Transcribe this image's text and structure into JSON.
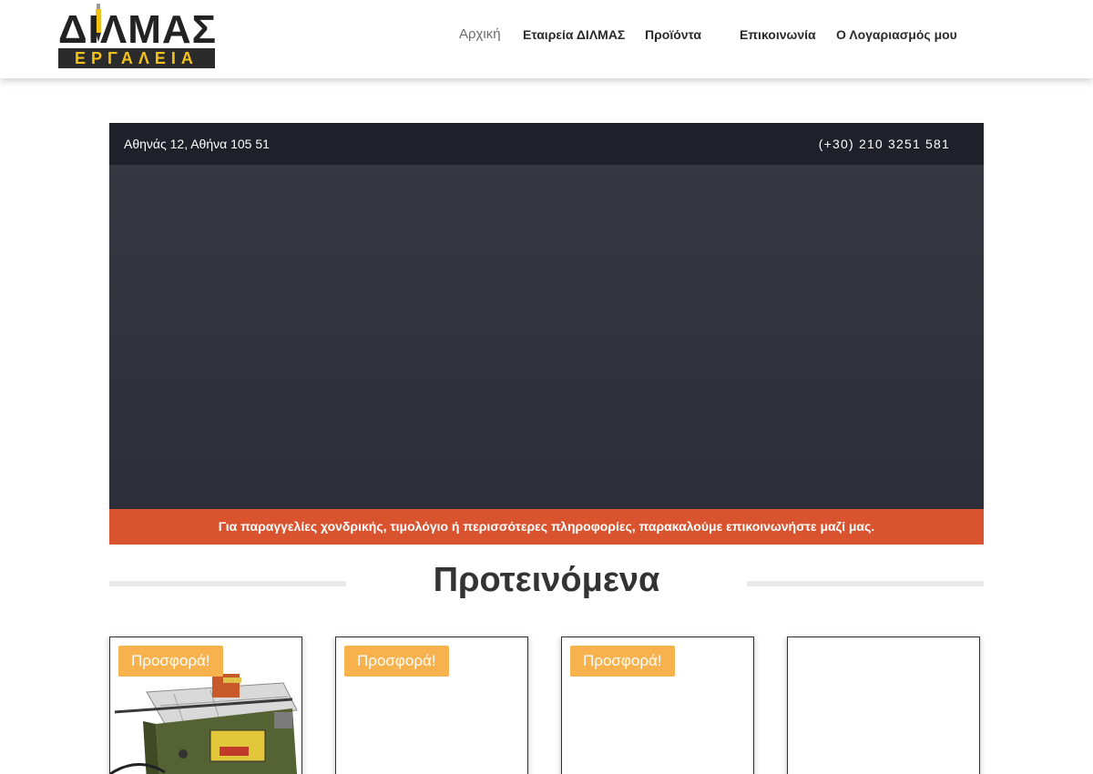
{
  "brand": {
    "logo_top": "ΔΙΛΜΑΣ",
    "logo_bottom": "ΕΡΓΑΛΕΙΑ",
    "logo_colors": {
      "dark": "#2b2b2b",
      "yellow": "#f2c21b"
    }
  },
  "nav": {
    "items": [
      {
        "label": "Αρχική",
        "active": true
      },
      {
        "label": "Εταιρεία ΔΙΛΜΑΣ",
        "active": false
      },
      {
        "label": "Προϊόντα",
        "active": false
      },
      {
        "label": "Επικοινωνία",
        "active": false
      },
      {
        "label": "Ο Λογαριασμός μου",
        "active": false
      }
    ]
  },
  "topbar": {
    "address": "Αθηνάς 12, Αθήνα 105 51",
    "phone": "(+30) 210 3251 581"
  },
  "notice": {
    "text": "Για παραγγελίες χονδρικής, τιμολόγιο ή περισσότερες πληροφορίες, παρακαλούμε επικοινωνήστε μαζί μας."
  },
  "featured": {
    "title": "Προτεινόμενα",
    "products": [
      {
        "badge": "Προσφορά!",
        "image_icon": "table-saw-image"
      },
      {
        "badge": "Προσφορά!"
      },
      {
        "badge": "Προσφορά!"
      },
      {}
    ]
  },
  "colors": {
    "topbar_bg": "#1f2029",
    "slider_bg": "#31333e",
    "notice_bg": "#d9532f",
    "badge_bg": "#f7b24d",
    "nav_active": "#6b6b6b"
  }
}
